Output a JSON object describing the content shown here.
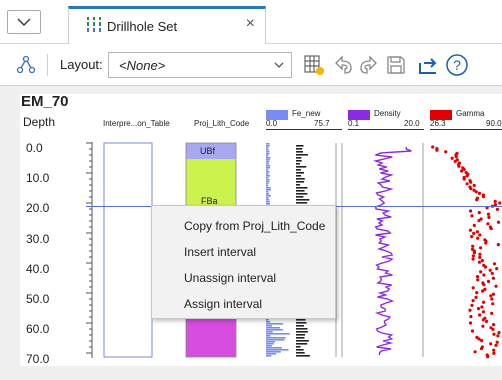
{
  "tab": {
    "title": "Drillhole Set",
    "close": "×"
  },
  "toolbar": {
    "layout_label": "Layout:",
    "layout_value": "<None>"
  },
  "log": {
    "hole_name": "EM_70",
    "depth_header": "Depth",
    "columns": [
      "Interpre...on_Table",
      "Proj_Lith_Code"
    ],
    "depth_ticks": [
      "0.0",
      "10.0",
      "20.0",
      "30.0",
      "40.0",
      "50.0",
      "60.0",
      "70.0"
    ],
    "lith_labels": [
      "UBf",
      "FBa"
    ],
    "legends": [
      {
        "name": "Fe_new",
        "min": "0.0",
        "max": "75.7",
        "color": "#7b8cf0"
      },
      {
        "name": "Density",
        "min": "0.1",
        "max": "20.0",
        "color": "#8a2be2"
      },
      {
        "name": "Gamma",
        "min": "26.3",
        "max": "90.0",
        "color": "#e00000"
      }
    ],
    "colors": {
      "lith_upper": "#ccf24e",
      "lith_lower": "#d64ddf",
      "lith_top": "#a8a8f0"
    }
  },
  "context_menu": {
    "items": [
      "Copy from Proj_Lith_Code",
      "Insert interval",
      "Unassign interval",
      "Assign interval"
    ]
  }
}
